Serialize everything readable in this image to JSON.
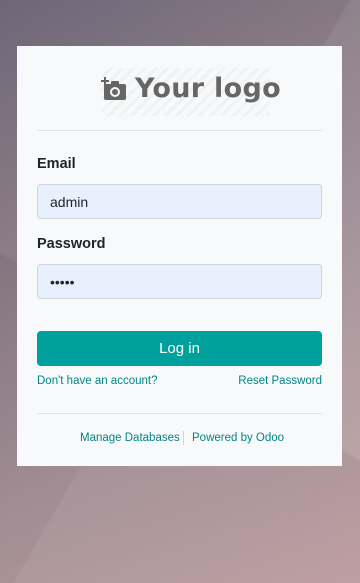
{
  "logo": {
    "text": "Your logo",
    "icon": "camera-plus-icon"
  },
  "form": {
    "email_label": "Email",
    "email_value": "admin",
    "password_label": "Password",
    "password_value": "admin",
    "login_label": "Log in"
  },
  "links": {
    "signup": "Don't have an account?",
    "reset": "Reset Password"
  },
  "footer": {
    "manage_db": "Manage Databases",
    "powered": "Powered by Odoo"
  },
  "colors": {
    "primary": "#00a09d",
    "link": "#018587",
    "input_bg": "#e8f0fe",
    "card_bg": "#f8f9fa"
  }
}
